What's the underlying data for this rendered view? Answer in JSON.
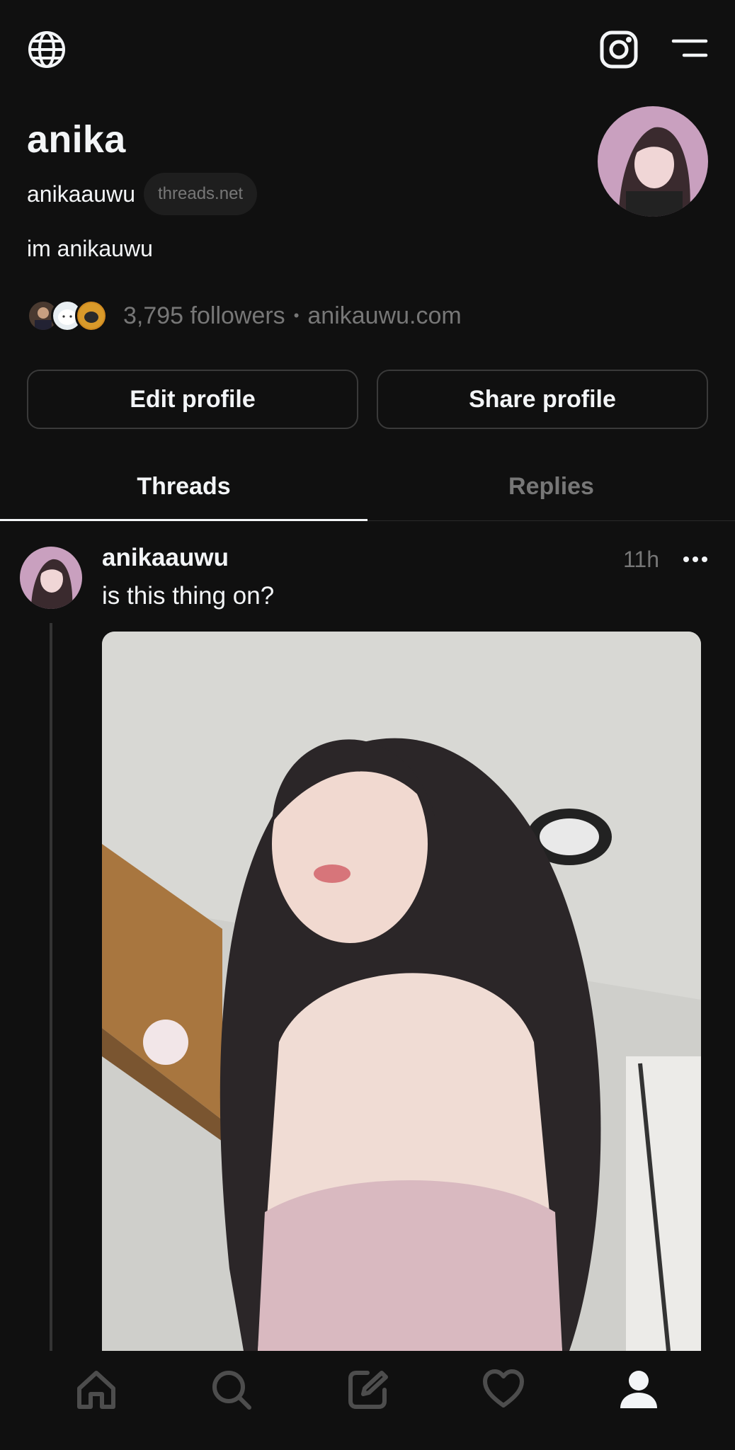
{
  "profile": {
    "name": "anika",
    "handle": "anikaauwu",
    "domain_badge": "threads.net",
    "bio": "im anikauwu",
    "followers": "3,795 followers",
    "separator": "•",
    "website": "anikauwu.com"
  },
  "buttons": {
    "edit": "Edit profile",
    "share": "Share profile"
  },
  "tabs": [
    {
      "label": "Threads",
      "active": true
    },
    {
      "label": "Replies",
      "active": false
    }
  ],
  "post": {
    "username": "anikaauwu",
    "time": "11h",
    "text": "is this thing on?"
  },
  "icons": {
    "top_left": "globe-icon",
    "top_right": [
      "instagram-icon",
      "menu-icon"
    ],
    "bottom_nav": [
      "home-icon",
      "search-icon",
      "compose-icon",
      "heart-icon",
      "profile-icon"
    ]
  },
  "colors": {
    "background": "#101010",
    "text": "#f3f5f7",
    "muted": "#777777",
    "border": "#3a3a3a"
  }
}
